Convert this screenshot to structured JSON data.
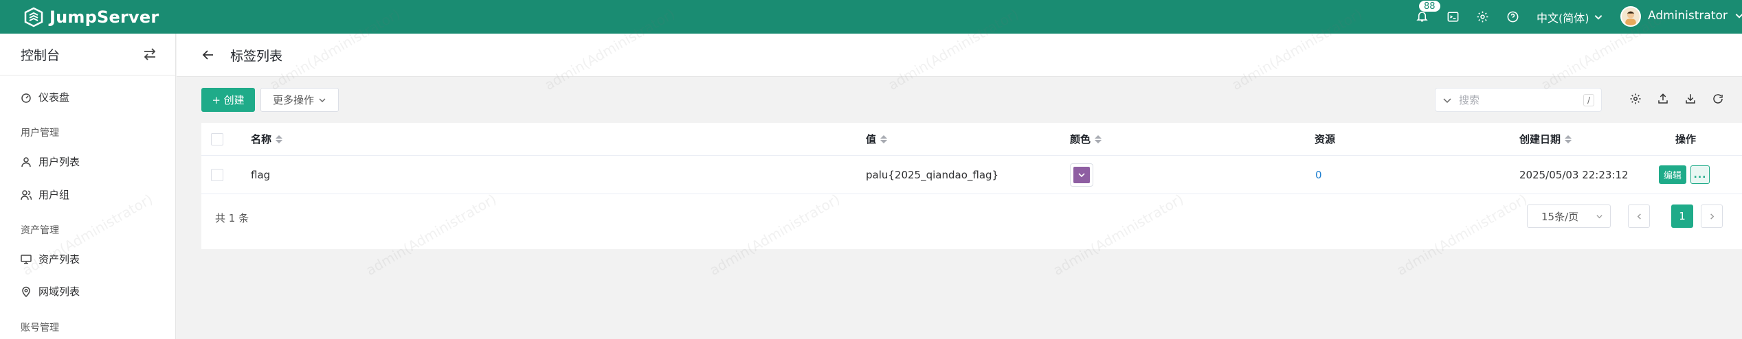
{
  "header": {
    "brand": "JumpServer",
    "notification_count": "88",
    "language": "中文(简体)",
    "user_name": "Administrator",
    "bg_color": "#1a8c72"
  },
  "sidebar": {
    "title": "控制台",
    "items": [
      {
        "label": "仪表盘",
        "icon": "dashboard-icon"
      },
      {
        "label": "用户列表",
        "icon": "user-icon"
      },
      {
        "label": "用户组",
        "icon": "user-group-icon"
      },
      {
        "label": "资产列表",
        "icon": "asset-icon"
      },
      {
        "label": "网域列表",
        "icon": "location-icon"
      }
    ],
    "groups": [
      "用户管理",
      "资产管理",
      "账号管理"
    ]
  },
  "page": {
    "title": "标签列表"
  },
  "toolbar": {
    "create_label": "+ 创建",
    "more_label": "更多操作",
    "search_placeholder": "搜索",
    "search_shortcut": "/"
  },
  "table": {
    "columns": [
      "名称",
      "值",
      "颜色",
      "资源",
      "创建日期",
      "操作"
    ],
    "rows": [
      {
        "name": "flag",
        "value": "palu{2025_qiandao_flag}",
        "color": "#8e5ea2",
        "resources": "0",
        "created": "2025/05/03 22:23:12",
        "edit_label": "编辑",
        "more_label": "..."
      }
    ],
    "total_text": "共 1 条",
    "page_size": "15条/页",
    "current_page": "1"
  },
  "watermark_text": "admin(Administrator)",
  "accent_color": "#1fab89"
}
